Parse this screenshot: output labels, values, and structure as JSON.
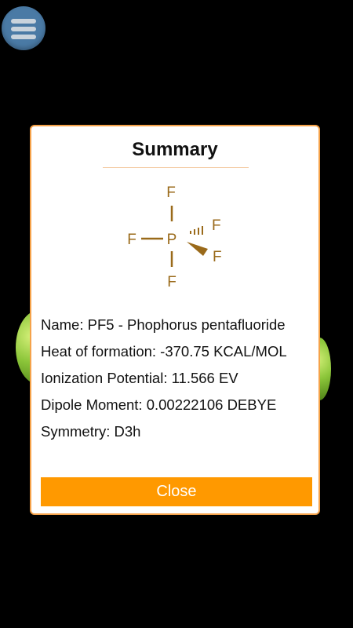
{
  "menu": {
    "icon": "hamburger-menu-icon"
  },
  "dialog": {
    "title": "Summary",
    "structure": {
      "central_atom": "P",
      "top": "F",
      "left": "F",
      "bottom": "F",
      "hashed": "F",
      "wedge": "F",
      "color": "#9a6a1a"
    },
    "info": {
      "name": "Name: PF5 - Phophorus pentafluoride",
      "heat": "Heat of formation: -370.75 KCAL/MOL",
      "ionization": "Ionization Potential: 11.566 EV",
      "dipole": "Dipole Moment: 0.00222106 DEBYE",
      "symmetry": "Symmetry: D3h"
    },
    "close_label": "Close"
  },
  "colors": {
    "accent": "#ff9900",
    "dialog_border": "#f5a24a",
    "menu_button": "#4a7aa5",
    "atom": "#8cc63a"
  }
}
